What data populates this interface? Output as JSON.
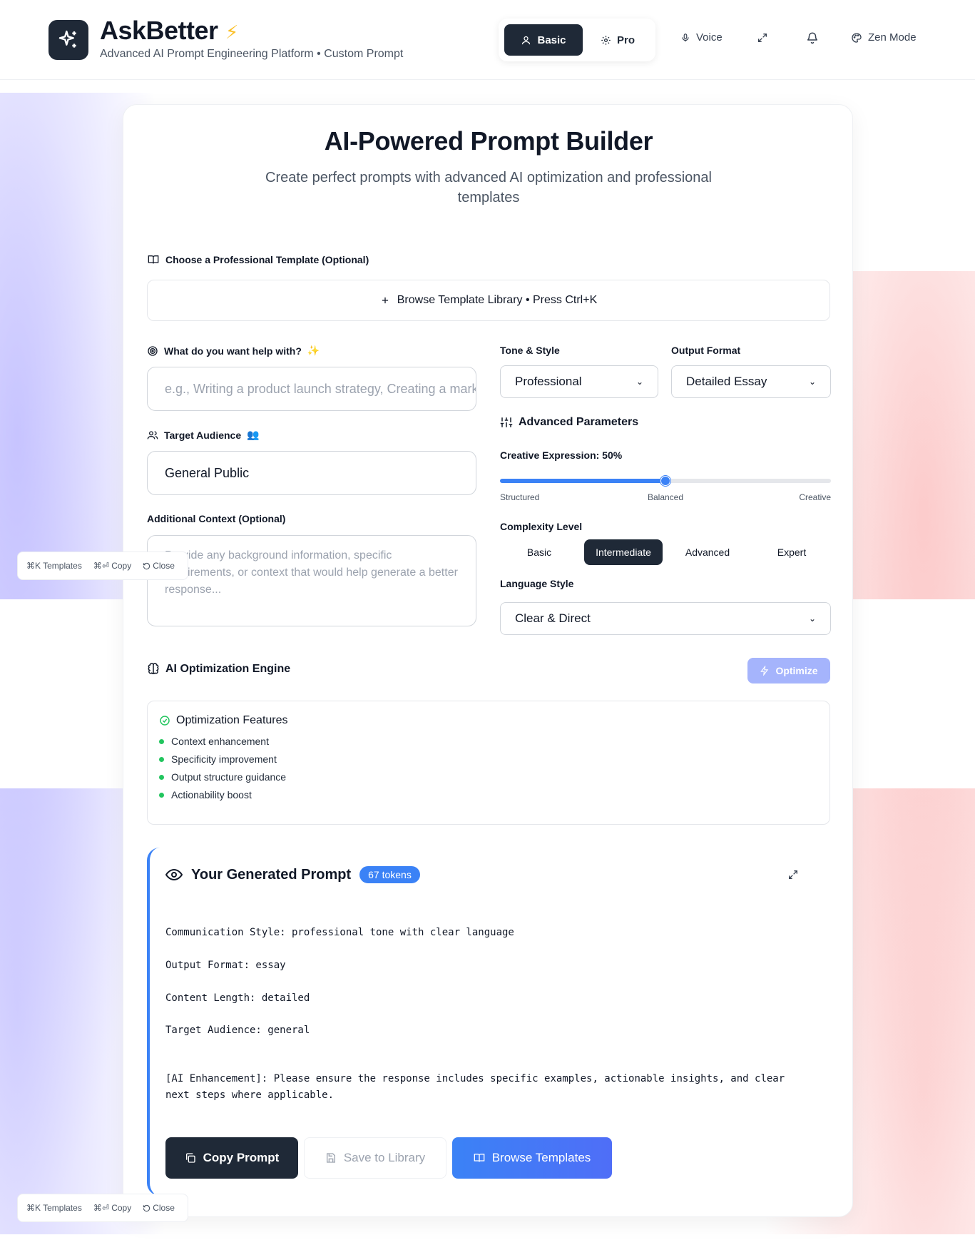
{
  "header": {
    "app_name": "AskBetter",
    "bolt": "⚡",
    "subtitle": "Advanced AI Prompt Engineering Platform • Custom Prompt",
    "modes": {
      "basic": "Basic",
      "pro": "Pro"
    },
    "voice": "Voice",
    "zen": "Zen Mode"
  },
  "hero": {
    "title": "AI-Powered Prompt Builder",
    "subtitle": "Create perfect prompts with advanced AI optimization and professional templates"
  },
  "template": {
    "label": "Choose a Professional Template (Optional)",
    "browse": "Browse Template Library • Press Ctrl+K"
  },
  "form": {
    "help_label": "What do you want help with?",
    "help_emoji": "✨",
    "help_placeholder": "e.g., Writing a product launch strategy, Creating a marketing plan",
    "audience_label": "Target Audience",
    "audience_emoji": "👥",
    "audience_value": "General Public",
    "context_label": "Additional Context (Optional)",
    "context_placeholder": "Provide any background information, specific requirements, or context that would help generate a better response..."
  },
  "settings": {
    "tone_label": "Tone & Style",
    "tone_value": "Professional",
    "format_label": "Output Format",
    "format_value": "Detailed Essay",
    "advanced_title": "Advanced Parameters",
    "creative_label": "Creative Expression: 50%",
    "creative_value": 0.5,
    "slider_ticks": [
      "Structured",
      "Balanced",
      "Creative"
    ],
    "complexity_label": "Complexity Level",
    "complexity_options": [
      "Basic",
      "Intermediate",
      "Advanced",
      "Expert"
    ],
    "complexity_selected": "Intermediate",
    "language_label": "Language Style",
    "language_value": "Clear & Direct"
  },
  "optimization": {
    "title": "AI Optimization Engine",
    "button": "Optimize",
    "features_title": "Optimization Features",
    "features": [
      "Context enhancement",
      "Specificity improvement",
      "Output structure guidance",
      "Actionability boost"
    ]
  },
  "generated": {
    "title": "Your Generated Prompt",
    "tokens": "67 tokens",
    "lines": [
      "Communication Style: professional tone with clear language",
      "Output Format: essay",
      "Content Length: detailed",
      "Target Audience: general",
      "[AI Enhancement]: Please ensure the response includes specific examples, actionable insights, and clear next steps where applicable."
    ],
    "copy_button": "Copy Prompt",
    "save_button": "Save to Library",
    "browse_button": "Browse Templates"
  },
  "shortcuts": {
    "templates": "⌘K Templates",
    "copy": "⌘⏎ Copy",
    "close": "Close"
  },
  "colors": {
    "primary_dark": "#1f2937",
    "accent_blue": "#3b82f6",
    "optimize_disabled": "#a5b4fc",
    "feature_dot": "#22c55e"
  }
}
